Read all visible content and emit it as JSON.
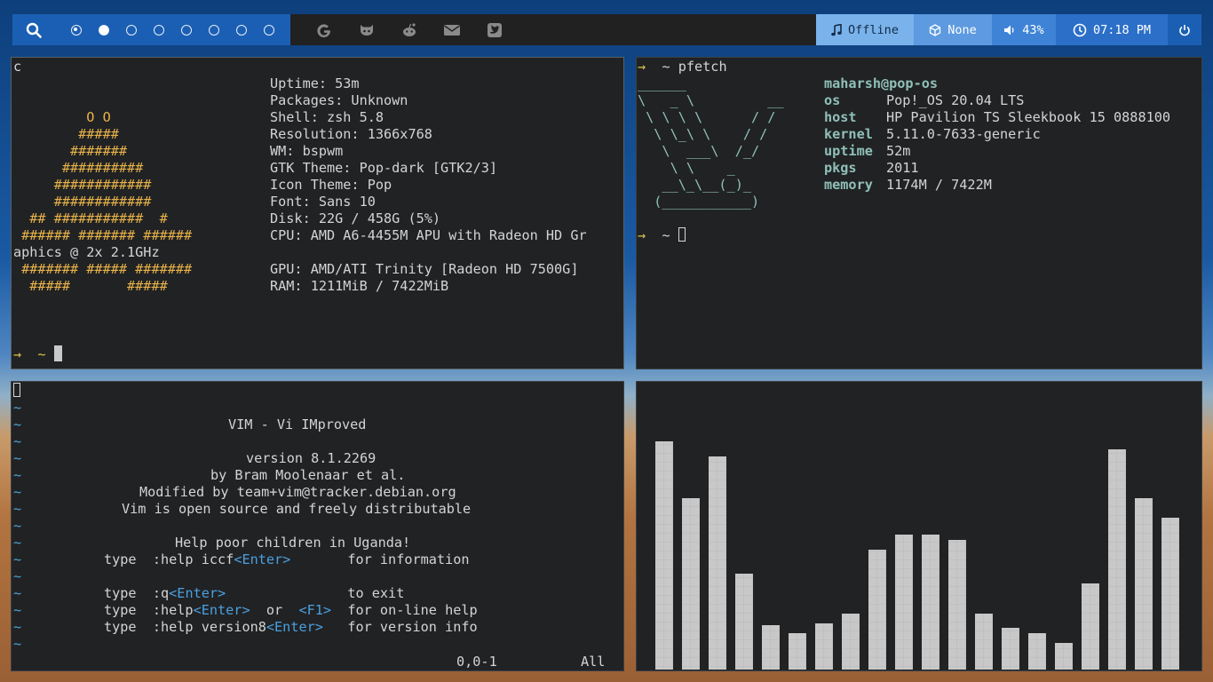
{
  "topbar": {
    "workspaces": [
      {
        "state": "active"
      },
      {
        "state": "occupied"
      },
      {
        "state": "empty"
      },
      {
        "state": "empty"
      },
      {
        "state": "empty"
      },
      {
        "state": "empty"
      },
      {
        "state": "empty"
      },
      {
        "state": "empty"
      }
    ],
    "apps": [
      "google-icon",
      "github-icon",
      "reddit-icon",
      "mail-icon",
      "twitter-icon"
    ],
    "music": "Offline",
    "updates": "None",
    "volume": "43%",
    "clock": "07:18 PM",
    "colors": {
      "bar_bg": "#212121",
      "accent": "#1b5fb4",
      "music_bg": "#7ab3ec"
    }
  },
  "neofetch": {
    "first_char": "c",
    "ascii": [
      "         O O",
      "        #####",
      "       #######",
      "      ##########",
      "     ############",
      "     ############",
      "  ## ###########  #",
      " ###### ####### ######",
      "aphics @ 2x 2.1GHz",
      " ####### ##### #######",
      "  #####       #####"
    ],
    "info": [
      "Uptime: 53m",
      "Packages: Unknown",
      "Shell: zsh 5.8",
      "Resolution: 1366x768",
      "WM: bspwm",
      "GTK Theme: Pop-dark [GTK2/3]",
      "Icon Theme: Pop",
      "Font: Sans 10",
      "Disk: 22G / 458G (5%)",
      "CPU: AMD A6-4455M APU with Radeon HD Gr",
      "",
      "GPU: AMD/ATI Trinity [Radeon HD 7500G]",
      "RAM: 1211MiB / 7422MiB"
    ],
    "prompt": "→  ~ "
  },
  "pfetch": {
    "command_prompt": "→  ~ pfetch",
    "logo": [
      "______",
      "\\   _ \\         __",
      " \\ \\ \\ \\      / /",
      "  \\ \\_\\ \\    / /",
      "   \\  ___\\  /_/",
      "    \\ \\    _",
      "   __\\_\\__(_)_",
      "  (___________)"
    ],
    "user_host": "maharsh@pop-os",
    "fields": [
      {
        "key": "os",
        "value": "Pop!_OS 20.04 LTS"
      },
      {
        "key": "host",
        "value": "HP Pavilion TS Sleekbook 15 0888100"
      },
      {
        "key": "kernel",
        "value": "5.11.0-7633-generic"
      },
      {
        "key": "uptime",
        "value": "52m"
      },
      {
        "key": "pkgs",
        "value": "2011"
      },
      {
        "key": "memory",
        "value": "1174M / 7422M"
      }
    ],
    "prompt": "→  ~ "
  },
  "vim": {
    "lines": [
      {
        "row": 2,
        "col": 12,
        "parts": [
          {
            "t": "VIM - Vi IMproved"
          }
        ]
      },
      {
        "row": 4,
        "col": 13,
        "parts": [
          {
            "t": "version 8.1.2269"
          }
        ]
      },
      {
        "row": 5,
        "col": 11,
        "parts": [
          {
            "t": "by Bram Moolenaar et al."
          }
        ]
      },
      {
        "row": 6,
        "col": 7,
        "parts": [
          {
            "t": "Modified by team+vim@tracker.debian.org"
          }
        ]
      },
      {
        "row": 7,
        "col": 6,
        "parts": [
          {
            "t": "Vim is open source and freely distributable"
          }
        ]
      },
      {
        "row": 9,
        "col": 9,
        "parts": [
          {
            "t": "Help poor children in Uganda!"
          }
        ]
      },
      {
        "row": 10,
        "col": 5,
        "parts": [
          {
            "t": "type  :help iccf"
          },
          {
            "t": "<Enter>",
            "c": "blue"
          },
          {
            "t": "       for information"
          }
        ]
      },
      {
        "row": 12,
        "col": 5,
        "parts": [
          {
            "t": "type  :q"
          },
          {
            "t": "<Enter>",
            "c": "blue"
          },
          {
            "t": "               to exit"
          }
        ]
      },
      {
        "row": 13,
        "col": 5,
        "parts": [
          {
            "t": "type  :help"
          },
          {
            "t": "<Enter>",
            "c": "blue"
          },
          {
            "t": "  or  "
          },
          {
            "t": "<F1>",
            "c": "blue"
          },
          {
            "t": "  for on-line help"
          }
        ]
      },
      {
        "row": 14,
        "col": 5,
        "parts": [
          {
            "t": "type  :help version8"
          },
          {
            "t": "<Enter>",
            "c": "blue"
          },
          {
            "t": "   for version info"
          }
        ]
      }
    ],
    "tilde_rows": 15,
    "status_pos": "0,0-1",
    "status_scroll": "All"
  },
  "visualizer": {
    "bar_color": "#c8c8c8",
    "levels": [
      0.93,
      0.7,
      0.87,
      0.39,
      0.18,
      0.15,
      0.19,
      0.23,
      0.49,
      0.55,
      0.55,
      0.53,
      0.23,
      0.17,
      0.15,
      0.11,
      0.35,
      0.9,
      0.7,
      0.62
    ]
  }
}
